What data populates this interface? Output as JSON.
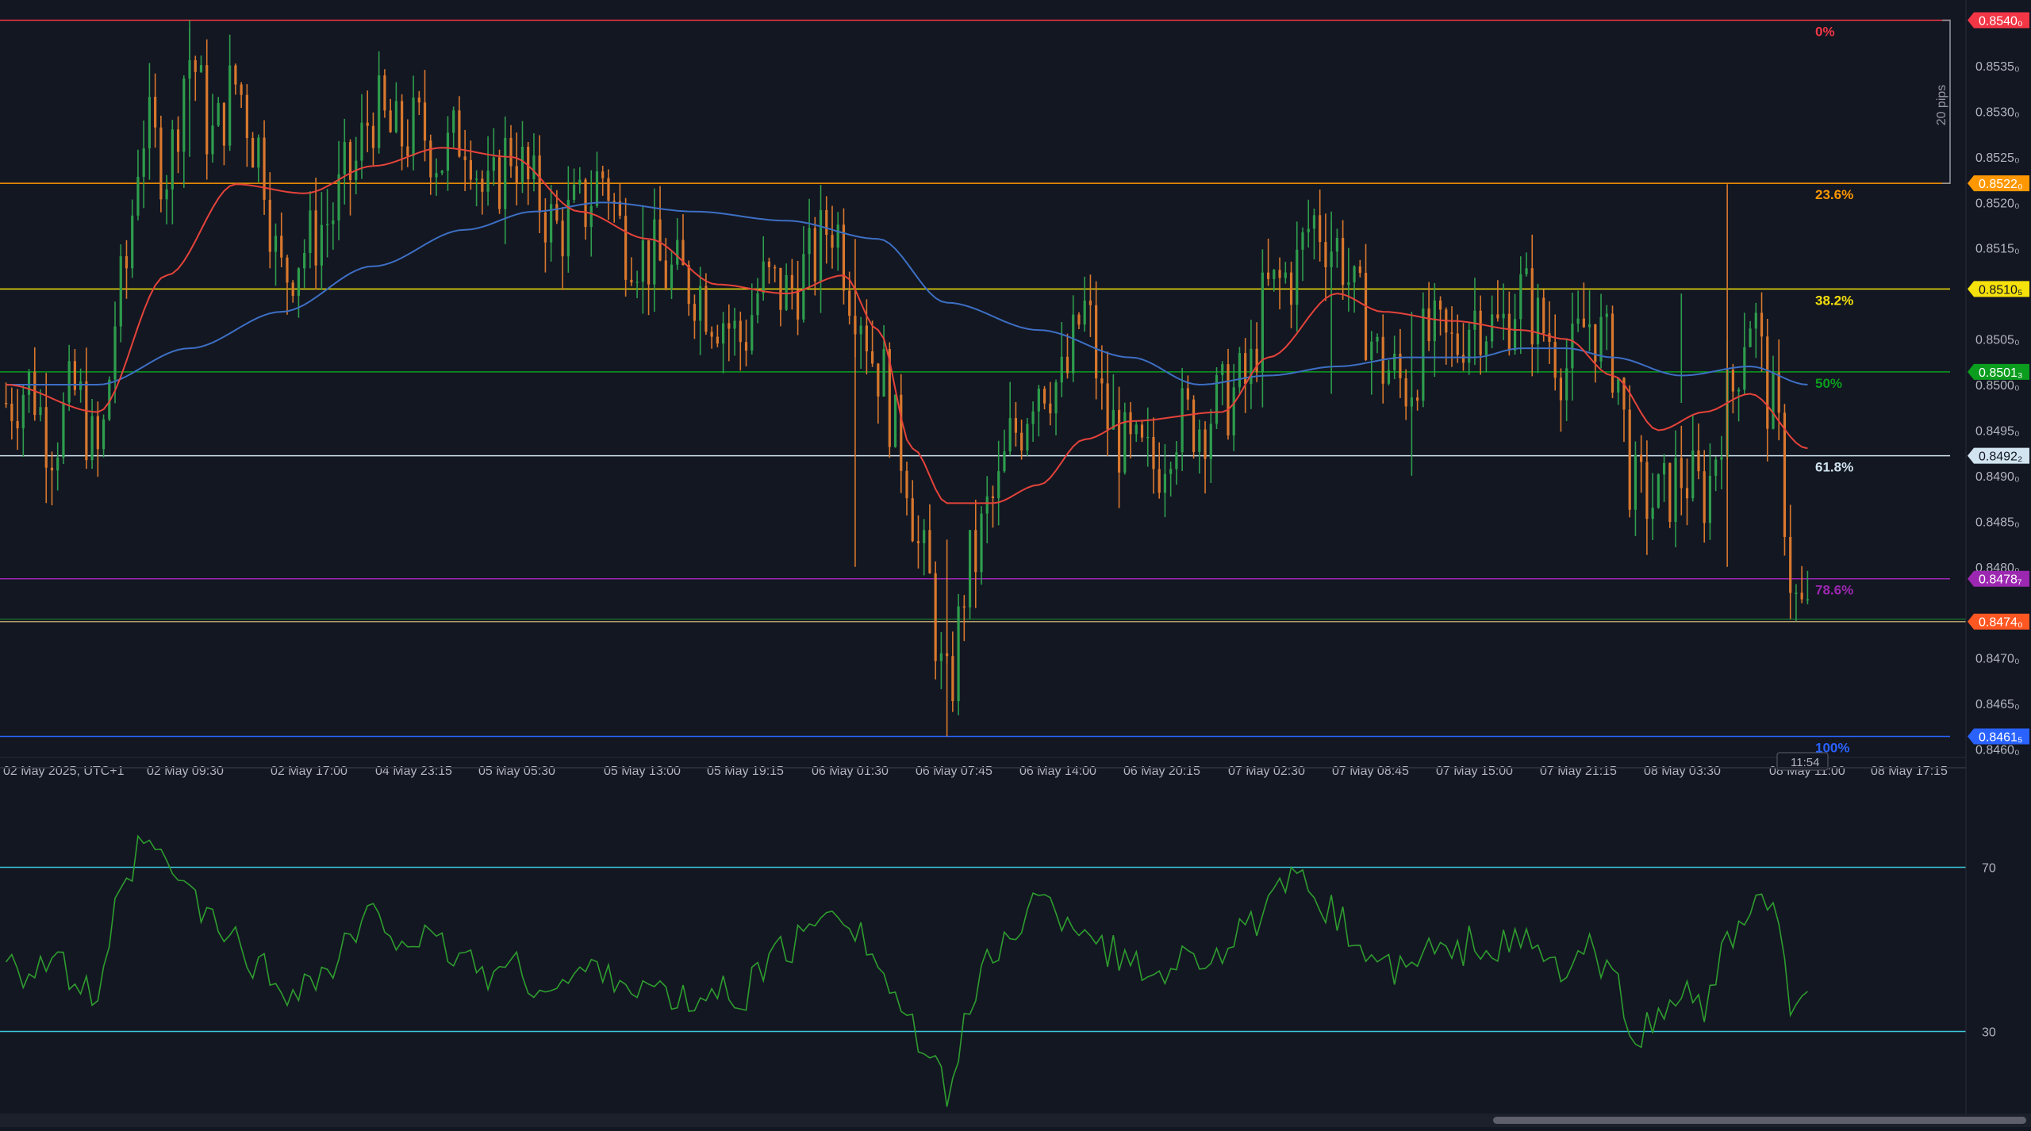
{
  "colors": {
    "background": "#131722",
    "grid_text": "#b2b5be",
    "bull": "#26a69a",
    "bull_candle": "#2e9d4d",
    "bear_candle": "#d9782d",
    "ema_fast": "#e5433a",
    "ema_slow": "#3d6fc4",
    "rsi_line": "#2e9d2e",
    "rsi_levels": "#3cc7d8"
  },
  "price_axis": {
    "labels": [
      "0.8535₀",
      "0.8530₀",
      "0.8525₀",
      "0.8520₀",
      "0.8515₀",
      "0.8505₀",
      "0.8500₀",
      "0.8495₀",
      "0.8490₀",
      "0.8485₀",
      "0.8480₀",
      "0.8470₀",
      "0.8465₀",
      "0.8460₀"
    ],
    "values": [
      0.8535,
      0.853,
      0.8525,
      0.852,
      0.8515,
      0.8505,
      0.85,
      0.8495,
      0.849,
      0.8485,
      0.848,
      0.847,
      0.8465,
      0.846
    ],
    "min": 0.84597,
    "max": 0.8541
  },
  "time_axis": {
    "labels": [
      "02 May 2025, UTC+1",
      "02 May 09:30",
      "02 May 17:00",
      "04 May 23:15",
      "05 May 05:30",
      "05 May 13:00",
      "05 May 19:15",
      "06 May 01:30",
      "06 May 07:45",
      "06 May 14:00",
      "06 May 20:15",
      "07 May 02:30",
      "07 May 08:45",
      "07 May 15:00",
      "07 May 21:15",
      "08 May 03:30",
      "08 May 11:00",
      "08 May 17:15"
    ],
    "countdown": "11:54"
  },
  "fib_levels": [
    {
      "label": "0%",
      "value": 0.854,
      "badge": "0.8540₀",
      "color": "#f23645"
    },
    {
      "label": "23.6%",
      "value": 0.85221,
      "badge": "0.8522₀",
      "color": "#ff9800"
    },
    {
      "label": "38.2%",
      "value": 0.85105,
      "badge": "0.8510₅",
      "color": "#f5e10b"
    },
    {
      "label": "50%",
      "value": 0.85014,
      "badge": "0.8501₃",
      "color": "#0b9d1e"
    },
    {
      "label": "61.8%",
      "value": 0.84922,
      "badge": "0.8492₂",
      "color": "#d1e4f0"
    },
    {
      "label": "78.6%",
      "value": 0.84787,
      "badge": "0.8478₇",
      "color": "#9c27b0"
    },
    {
      "label": "100%",
      "value": 0.84614,
      "badge": "0.8461₅",
      "color": "#2962ff"
    }
  ],
  "current_price": {
    "value": 0.8474,
    "badge": "0.8474₀",
    "color": "#ff5722"
  },
  "measure": {
    "label": "20 pips"
  },
  "rsi": {
    "levels": [
      70,
      30
    ],
    "labels": [
      "70",
      "30"
    ]
  },
  "chart_data": {
    "type": "candlestick",
    "instrument_pair_note": "",
    "price_anchors": [
      [
        0,
        0.8498
      ],
      [
        4,
        0.85
      ],
      [
        8,
        0.8494
      ],
      [
        12,
        0.8499
      ],
      [
        16,
        0.8492
      ],
      [
        20,
        0.851
      ],
      [
        24,
        0.8528
      ],
      [
        28,
        0.8524
      ],
      [
        32,
        0.8536
      ],
      [
        36,
        0.8527
      ],
      [
        40,
        0.8533
      ],
      [
        44,
        0.8526
      ],
      [
        48,
        0.8512
      ],
      [
        52,
        0.8515
      ],
      [
        56,
        0.8518
      ],
      [
        60,
        0.8523
      ],
      [
        64,
        0.853
      ],
      [
        68,
        0.8527
      ],
      [
        72,
        0.8528
      ],
      [
        76,
        0.8525
      ],
      [
        80,
        0.8528
      ],
      [
        84,
        0.852
      ],
      [
        88,
        0.8526
      ],
      [
        92,
        0.8521
      ],
      [
        96,
        0.8517
      ],
      [
        100,
        0.8519
      ],
      [
        104,
        0.8523
      ],
      [
        108,
        0.8516
      ],
      [
        112,
        0.8514
      ],
      [
        116,
        0.8512
      ],
      [
        120,
        0.8511
      ],
      [
        124,
        0.8508
      ],
      [
        128,
        0.8505
      ],
      [
        132,
        0.8511
      ],
      [
        136,
        0.851
      ],
      [
        140,
        0.8513
      ],
      [
        144,
        0.8518
      ],
      [
        148,
        0.851
      ],
      [
        152,
        0.8502
      ],
      [
        156,
        0.8493
      ],
      [
        160,
        0.848
      ],
      [
        164,
        0.8466
      ],
      [
        168,
        0.848
      ],
      [
        172,
        0.8487
      ],
      [
        176,
        0.8495
      ],
      [
        180,
        0.8501
      ],
      [
        184,
        0.85
      ],
      [
        188,
        0.8508
      ],
      [
        192,
        0.8496
      ],
      [
        196,
        0.8492
      ],
      [
        200,
        0.8491
      ],
      [
        204,
        0.8496
      ],
      [
        208,
        0.8496
      ],
      [
        212,
        0.8498
      ],
      [
        216,
        0.85
      ],
      [
        220,
        0.851
      ],
      [
        224,
        0.8512
      ],
      [
        228,
        0.8518
      ],
      [
        232,
        0.8515
      ],
      [
        236,
        0.8508
      ],
      [
        240,
        0.8502
      ],
      [
        244,
        0.85
      ],
      [
        248,
        0.8505
      ],
      [
        252,
        0.8504
      ],
      [
        256,
        0.8508
      ],
      [
        260,
        0.8506
      ],
      [
        264,
        0.851
      ],
      [
        268,
        0.8506
      ],
      [
        272,
        0.8502
      ],
      [
        276,
        0.8507
      ],
      [
        280,
        0.8503
      ],
      [
        284,
        0.8488
      ],
      [
        288,
        0.8487
      ],
      [
        292,
        0.849
      ],
      [
        296,
        0.8488
      ],
      [
        300,
        0.8498
      ],
      [
        304,
        0.8508
      ],
      [
        308,
        0.8497
      ],
      [
        312,
        0.8476
      ],
      [
        314,
        0.8474
      ]
    ],
    "ema_fast_anchors": [
      [
        0,
        0.85
      ],
      [
        16,
        0.8497
      ],
      [
        28,
        0.8512
      ],
      [
        40,
        0.8522
      ],
      [
        52,
        0.8521
      ],
      [
        64,
        0.8524
      ],
      [
        76,
        0.8526
      ],
      [
        88,
        0.8525
      ],
      [
        100,
        0.8519
      ],
      [
        112,
        0.8516
      ],
      [
        124,
        0.8511
      ],
      [
        136,
        0.851
      ],
      [
        146,
        0.8512
      ],
      [
        152,
        0.8506
      ],
      [
        158,
        0.8493
      ],
      [
        164,
        0.8487
      ],
      [
        172,
        0.8487
      ],
      [
        180,
        0.8489
      ],
      [
        188,
        0.8494
      ],
      [
        196,
        0.8496
      ],
      [
        212,
        0.8497
      ],
      [
        220,
        0.8503
      ],
      [
        232,
        0.851
      ],
      [
        240,
        0.8508
      ],
      [
        252,
        0.8507
      ],
      [
        264,
        0.8506
      ],
      [
        272,
        0.8505
      ],
      [
        280,
        0.8501
      ],
      [
        288,
        0.8495
      ],
      [
        296,
        0.8497
      ],
      [
        304,
        0.8499
      ],
      [
        314,
        0.8493
      ]
    ],
    "ema_slow_anchors": [
      [
        0,
        0.85
      ],
      [
        16,
        0.85
      ],
      [
        32,
        0.8504
      ],
      [
        48,
        0.8508
      ],
      [
        64,
        0.8513
      ],
      [
        80,
        0.8517
      ],
      [
        92,
        0.8519
      ],
      [
        104,
        0.852
      ],
      [
        120,
        0.8519
      ],
      [
        136,
        0.8518
      ],
      [
        152,
        0.8516
      ],
      [
        164,
        0.8509
      ],
      [
        180,
        0.8506
      ],
      [
        196,
        0.8503
      ],
      [
        208,
        0.85
      ],
      [
        220,
        0.8501
      ],
      [
        232,
        0.8502
      ],
      [
        244,
        0.8503
      ],
      [
        256,
        0.8503
      ],
      [
        264,
        0.8504
      ],
      [
        272,
        0.8504
      ],
      [
        280,
        0.8503
      ],
      [
        292,
        0.8501
      ],
      [
        304,
        0.8502
      ],
      [
        314,
        0.85
      ]
    ],
    "rsi_anchors": [
      [
        0,
        50
      ],
      [
        4,
        44
      ],
      [
        8,
        48
      ],
      [
        12,
        42
      ],
      [
        16,
        38
      ],
      [
        20,
        62
      ],
      [
        24,
        76
      ],
      [
        28,
        70
      ],
      [
        32,
        64
      ],
      [
        36,
        56
      ],
      [
        40,
        52
      ],
      [
        44,
        46
      ],
      [
        48,
        40
      ],
      [
        52,
        42
      ],
      [
        56,
        44
      ],
      [
        60,
        52
      ],
      [
        64,
        58
      ],
      [
        68,
        54
      ],
      [
        72,
        52
      ],
      [
        76,
        50
      ],
      [
        80,
        48
      ],
      [
        84,
        44
      ],
      [
        88,
        46
      ],
      [
        92,
        42
      ],
      [
        96,
        40
      ],
      [
        100,
        44
      ],
      [
        104,
        46
      ],
      [
        108,
        42
      ],
      [
        112,
        40
      ],
      [
        116,
        38
      ],
      [
        120,
        36
      ],
      [
        124,
        40
      ],
      [
        128,
        38
      ],
      [
        132,
        46
      ],
      [
        136,
        50
      ],
      [
        140,
        54
      ],
      [
        144,
        62
      ],
      [
        148,
        56
      ],
      [
        152,
        46
      ],
      [
        156,
        36
      ],
      [
        160,
        24
      ],
      [
        164,
        16
      ],
      [
        168,
        36
      ],
      [
        172,
        48
      ],
      [
        176,
        56
      ],
      [
        180,
        62
      ],
      [
        184,
        58
      ],
      [
        188,
        56
      ],
      [
        192,
        50
      ],
      [
        196,
        46
      ],
      [
        200,
        44
      ],
      [
        204,
        48
      ],
      [
        208,
        48
      ],
      [
        212,
        50
      ],
      [
        216,
        54
      ],
      [
        220,
        60
      ],
      [
        224,
        66
      ],
      [
        228,
        64
      ],
      [
        232,
        58
      ],
      [
        236,
        50
      ],
      [
        240,
        46
      ],
      [
        244,
        44
      ],
      [
        248,
        50
      ],
      [
        252,
        48
      ],
      [
        256,
        52
      ],
      [
        260,
        50
      ],
      [
        264,
        52
      ],
      [
        268,
        48
      ],
      [
        272,
        44
      ],
      [
        276,
        50
      ],
      [
        280,
        42
      ],
      [
        284,
        30
      ],
      [
        288,
        32
      ],
      [
        292,
        40
      ],
      [
        296,
        36
      ],
      [
        300,
        50
      ],
      [
        304,
        60
      ],
      [
        308,
        58
      ],
      [
        312,
        34
      ],
      [
        314,
        36
      ]
    ],
    "rsi_range": [
      10,
      90
    ],
    "bars": 315
  }
}
